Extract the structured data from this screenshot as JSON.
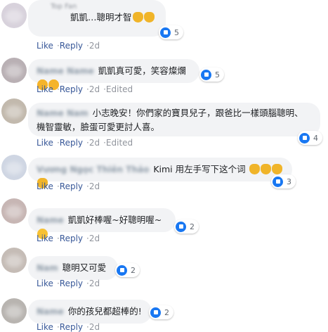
{
  "comments": [
    {
      "author_hidden": true,
      "badge": "Top Fan",
      "text": "凱凱…聰明才智",
      "emoji": [
        "clap",
        "clap"
      ],
      "likes": "5",
      "time": "2d",
      "edited": ""
    },
    {
      "author_hidden": true,
      "text": "凱凱真可愛，笑容燦爛",
      "emoji": [
        "heart",
        "heart"
      ],
      "likes": "5",
      "time": "2d",
      "edited": "Edited"
    },
    {
      "author_hidden": true,
      "text": "小志晚安！你們家的寶貝兒子，跟爸比一樣頭腦聰明、機智靈敏，臉蛋可愛更討人喜。",
      "emoji": [],
      "likes": "4",
      "time": "2d",
      "edited": "Edited"
    },
    {
      "author": "Vương Ngọc Thiên Thảo",
      "text": "Kimi 用左手写下这个词",
      "emoji": [
        "clap",
        "clap",
        "clap",
        "clap"
      ],
      "likes": "3",
      "time": "2d",
      "edited": ""
    },
    {
      "author_hidden": true,
      "text": "凱凱好棒喔~好聰明喔~",
      "emoji": [
        "wink"
      ],
      "likes": "2",
      "time": "2d",
      "edited": ""
    },
    {
      "author_hidden": true,
      "text": "聰明又可愛",
      "emoji": [],
      "likes": "2",
      "time": "2d",
      "edited": ""
    },
    {
      "author_hidden": true,
      "text": "你的孩兒都超棒的!",
      "emoji": [],
      "likes": "2",
      "time": "2d",
      "edited": ""
    }
  ],
  "actions": {
    "like": "Like",
    "reply": "Reply"
  },
  "colors": {
    "bubble": "#f2f3f5",
    "link": "#385898",
    "like_blue": "#1877f2"
  }
}
